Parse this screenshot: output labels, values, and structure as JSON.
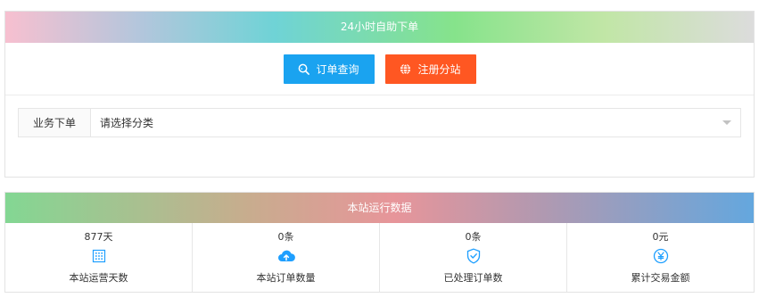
{
  "order_panel": {
    "title": "24小时自助下单",
    "buttons": {
      "query_label": "订单查询",
      "query_icon": "search-icon",
      "register_label": "注册分站",
      "register_icon": "globe-icon"
    },
    "category": {
      "label": "业务下单",
      "selected": "请选择分类"
    }
  },
  "stats_panel": {
    "title": "本站运行数据",
    "items": [
      {
        "value": "877天",
        "label": "本站运营天数",
        "icon": "calendar-icon"
      },
      {
        "value": "0条",
        "label": "本站订单数量",
        "icon": "cloud-upload-icon"
      },
      {
        "value": "0条",
        "label": "已处理订单数",
        "icon": "shield-check-icon"
      },
      {
        "value": "0元",
        "label": "累计交易金额",
        "icon": "yen-circle-icon"
      }
    ]
  },
  "colors": {
    "query_button": "#1aa3f0",
    "register_button": "#ff5722",
    "icon_blue": "#1e9fff"
  }
}
